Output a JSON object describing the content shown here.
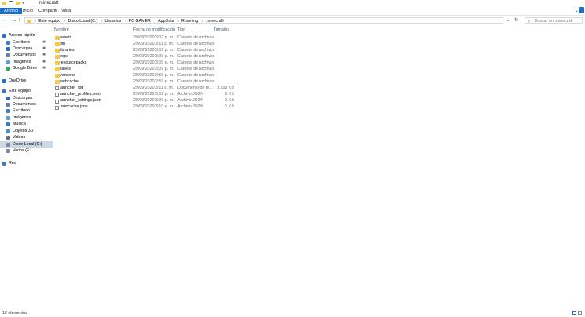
{
  "window": {
    "title": ".minecraft"
  },
  "ribbon": {
    "tabs": [
      "Archivo",
      "Inicio",
      "Compartir",
      "Vista"
    ]
  },
  "address": {
    "breadcrumb": [
      "Este equipo",
      "Disco Local (C:)",
      "Usuarios",
      "PC GAMER",
      "AppData",
      "Roaming",
      ".minecraft"
    ],
    "search_placeholder": "Buscar en .minecraft"
  },
  "sidebar": {
    "items": [
      {
        "label": "Acceso rápido",
        "icon": "star-icon",
        "color": "#2f6bc2"
      },
      {
        "label": "Escritorio",
        "icon": "desktop-icon",
        "color": "#3b7bd4",
        "pinned": true
      },
      {
        "label": "Descargas",
        "icon": "download-icon",
        "color": "#2f6bc2",
        "pinned": true
      },
      {
        "label": "Documentos",
        "icon": "documents-icon",
        "color": "#5b7fa6",
        "pinned": true
      },
      {
        "label": "Imágenes",
        "icon": "pictures-icon",
        "color": "#5aa0d8",
        "pinned": true
      },
      {
        "label": "Google Drive",
        "icon": "google-drive-icon",
        "color": "#34a853",
        "pinned": true
      },
      {
        "label": "OneDrive",
        "icon": "onedrive-icon",
        "color": "#1a6fc9"
      },
      {
        "label": "Este equipo",
        "icon": "computer-icon",
        "color": "#3a78c3"
      },
      {
        "label": "Descargas",
        "icon": "download-icon",
        "color": "#2f6bc2"
      },
      {
        "label": "Documentos",
        "icon": "documents-icon",
        "color": "#5b7fa6"
      },
      {
        "label": "Escritorio",
        "icon": "desktop-icon",
        "color": "#3b7bd4"
      },
      {
        "label": "Imágenes",
        "icon": "pictures-icon",
        "color": "#5aa0d8"
      },
      {
        "label": "Música",
        "icon": "music-icon",
        "color": "#3a78c3"
      },
      {
        "label": "Objetos 3D",
        "icon": "3d-objects-icon",
        "color": "#4a90c8"
      },
      {
        "label": "Videos",
        "icon": "videos-icon",
        "color": "#5b6f86"
      },
      {
        "label": "Disco Local (C:)",
        "icon": "drive-icon",
        "color": "#7a8a9a",
        "selected": true
      },
      {
        "label": "Varios (F:)",
        "icon": "drive-icon",
        "color": "#7a8a9a"
      },
      {
        "label": "Red",
        "icon": "network-icon",
        "color": "#3a78c3"
      }
    ]
  },
  "columns": {
    "name": "Nombre",
    "date": "Fecha de modificación",
    "type": "Tipo",
    "size": "Tamaño"
  },
  "files": [
    {
      "name": "assets",
      "date": "29/09/2020 3:02 p. m.",
      "type": "Carpeta de archivos",
      "size": "",
      "kind": "folder"
    },
    {
      "name": "bin",
      "date": "29/09/2020 3:11 p. m.",
      "type": "Carpeta de archivos",
      "size": "",
      "kind": "folder"
    },
    {
      "name": "libraries",
      "date": "29/09/2020 3:02 p. m.",
      "type": "Carpeta de archivos",
      "size": "",
      "kind": "folder"
    },
    {
      "name": "logs",
      "date": "29/09/2020 3:09 p. m.",
      "type": "Carpeta de archivos",
      "size": "",
      "kind": "folder"
    },
    {
      "name": "resourcepacks",
      "date": "29/09/2020 3:09 p. m.",
      "type": "Carpeta de archivos",
      "size": "",
      "kind": "folder"
    },
    {
      "name": "saves",
      "date": "29/09/2020 3:09 p. m.",
      "type": "Carpeta de archivos",
      "size": "",
      "kind": "folder"
    },
    {
      "name": "versions",
      "date": "29/09/2020 2:59 p. m.",
      "type": "Carpeta de archivos",
      "size": "",
      "kind": "folder"
    },
    {
      "name": "webcache",
      "date": "29/09/2020 2:59 p. m.",
      "type": "Carpeta de archivos",
      "size": "",
      "kind": "folder"
    },
    {
      "name": "launcher_log",
      "date": "29/09/2020 3:11 p. m.",
      "type": "Documento de te...",
      "size": "3,195 KB",
      "kind": "file"
    },
    {
      "name": "launcher_profiles.json",
      "date": "29/09/2020 3:02 p. m.",
      "type": "Archivo JSON",
      "size": "2 KB",
      "kind": "file"
    },
    {
      "name": "launcher_settings.json",
      "date": "29/09/2020 3:09 p. m.",
      "type": "Archivo JSON",
      "size": "1 KB",
      "kind": "file"
    },
    {
      "name": "usercache.json",
      "date": "29/09/2020 3:10 p. m.",
      "type": "Archivo JSON",
      "size": "1 KB",
      "kind": "file"
    }
  ],
  "status": {
    "count": "12 elementos"
  }
}
